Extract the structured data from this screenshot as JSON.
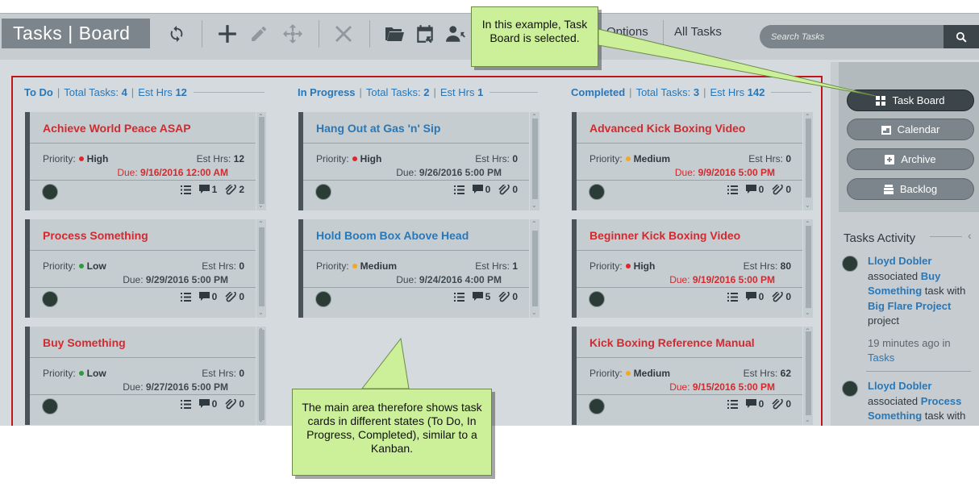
{
  "app_title": {
    "tasks": "Tasks",
    "sep": "|",
    "board": "Board"
  },
  "toolbar": {
    "options_label": "Options",
    "all_tasks_label": "All Tasks"
  },
  "search": {
    "placeholder": "Search Tasks"
  },
  "columns": [
    {
      "name": "To Do",
      "total_label": "Total Tasks:",
      "total": "4",
      "hrs_label": "Est Hrs",
      "hrs": "12",
      "cards": [
        {
          "title": "Achieve World Peace ASAP",
          "priority_label": "Priority:",
          "priority": "High",
          "est_label": "Est Hrs:",
          "est": "12",
          "due_label": "Due:",
          "due": "9/16/2016 12:00 AM",
          "comments": "1",
          "attachments": "2"
        },
        {
          "title": "Process Something",
          "priority_label": "Priority:",
          "priority": "Low",
          "est_label": "Est Hrs:",
          "est": "0",
          "due_label": "Due:",
          "due": "9/29/2016 5:00 PM",
          "comments": "0",
          "attachments": "0"
        },
        {
          "title": "Buy Something",
          "priority_label": "Priority:",
          "priority": "Low",
          "est_label": "Est Hrs:",
          "est": "0",
          "due_label": "Due:",
          "due": "9/27/2016 5:00 PM",
          "comments": "0",
          "attachments": "0"
        }
      ]
    },
    {
      "name": "In Progress",
      "total_label": "Total Tasks:",
      "total": "2",
      "hrs_label": "Est Hrs",
      "hrs": "1",
      "cards": [
        {
          "title": "Hang Out at Gas 'n' Sip",
          "priority_label": "Priority:",
          "priority": "High",
          "est_label": "Est Hrs:",
          "est": "0",
          "due_label": "Due:",
          "due": "9/26/2016 5:00 PM",
          "comments": "0",
          "attachments": "0"
        },
        {
          "title": "Hold Boom Box Above Head",
          "priority_label": "Priority:",
          "priority": "Medium",
          "est_label": "Est Hrs:",
          "est": "1",
          "due_label": "Due:",
          "due": "9/24/2016 4:00 PM",
          "comments": "5",
          "attachments": "0"
        }
      ]
    },
    {
      "name": "Completed",
      "total_label": "Total Tasks:",
      "total": "3",
      "hrs_label": "Est Hrs",
      "hrs": "142",
      "cards": [
        {
          "title": "Advanced Kick Boxing Video",
          "priority_label": "Priority:",
          "priority": "Medium",
          "est_label": "Est Hrs:",
          "est": "0",
          "due_label": "Due:",
          "due": "9/9/2016 5:00 PM",
          "comments": "0",
          "attachments": "0"
        },
        {
          "title": "Beginner Kick Boxing Video",
          "priority_label": "Priority:",
          "priority": "High",
          "est_label": "Est Hrs:",
          "est": "80",
          "due_label": "Due:",
          "due": "9/19/2016 5:00 PM",
          "comments": "0",
          "attachments": "0"
        },
        {
          "title": "Kick Boxing Reference Manual",
          "priority_label": "Priority:",
          "priority": "Medium",
          "est_label": "Est Hrs:",
          "est": "62",
          "due_label": "Due:",
          "due": "9/15/2016 5:00 PM",
          "comments": "0",
          "attachments": "0"
        }
      ]
    }
  ],
  "views": [
    {
      "label": "Task Board",
      "icon": "grid-icon"
    },
    {
      "label": "Calendar",
      "icon": "calendar-icon"
    },
    {
      "label": "Archive",
      "icon": "archive-icon"
    },
    {
      "label": "Backlog",
      "icon": "backlog-icon"
    }
  ],
  "activity": {
    "title": "Tasks Activity",
    "items": [
      {
        "user": "Lloyd Dobler",
        "verb": "associated",
        "task": "Buy Something",
        "suffix": "task with",
        "project": "Big Flare Project",
        "tail": "project",
        "time": "19 minutes ago in",
        "where": "Tasks"
      },
      {
        "user": "Lloyd Dobler",
        "verb": "associated",
        "task": "Process Something",
        "suffix": "task with"
      }
    ]
  },
  "callouts": {
    "top": "In this example, Task Board is selected.",
    "bottom": "The main area therefore shows task cards in different states (To Do, In Progress, Completed), similar to a Kanban."
  },
  "colors": {
    "high": "#e0262c",
    "medium": "#f5a623",
    "low": "#2d9a3b",
    "overdue": "#d22a2f",
    "link": "#2a77b7"
  }
}
